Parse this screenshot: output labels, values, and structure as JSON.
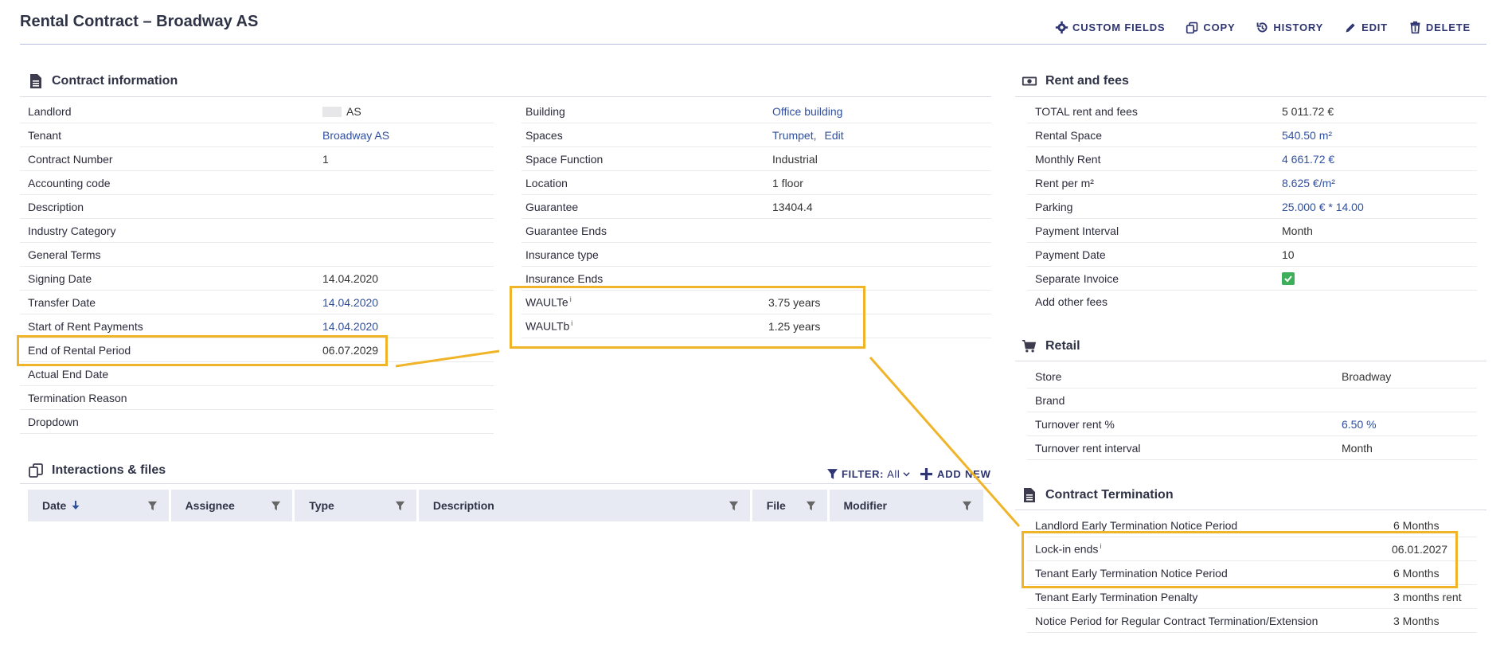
{
  "page_title": "Rental Contract – Broadway AS",
  "toolbar": {
    "custom_fields": "CUSTOM FIELDS",
    "copy": "COPY",
    "history": "HISTORY",
    "edit": "EDIT",
    "delete": "DELETE"
  },
  "contract_info": {
    "title": "Contract information",
    "left_rows": [
      {
        "label": "Landlord",
        "value": "AS"
      },
      {
        "label": "Tenant",
        "value": "Broadway AS"
      },
      {
        "label": "Contract Number",
        "value": "1"
      },
      {
        "label": "Accounting code",
        "value": ""
      },
      {
        "label": "Description",
        "value": ""
      },
      {
        "label": "Industry Category",
        "value": ""
      },
      {
        "label": "General Terms",
        "value": ""
      },
      {
        "label": "Signing Date",
        "value": "14.04.2020"
      },
      {
        "label": "Transfer Date",
        "value": "14.04.2020"
      },
      {
        "label": "Start of Rent Payments",
        "value": "14.04.2020"
      },
      {
        "label": "End of Rental Period",
        "value": "06.07.2029"
      },
      {
        "label": "Actual End Date",
        "value": ""
      },
      {
        "label": "Termination Reason",
        "value": ""
      },
      {
        "label": "Dropdown",
        "value": ""
      }
    ],
    "right_rows": [
      {
        "label": "Building",
        "value": "Office building"
      },
      {
        "label": "Spaces",
        "value": "Trumpet,",
        "extra": "Edit"
      },
      {
        "label": "Space Function",
        "value": "Industrial"
      },
      {
        "label": "Location",
        "value": "1 floor"
      },
      {
        "label": "Guarantee",
        "value": "13404.4"
      },
      {
        "label": "Guarantee Ends",
        "value": ""
      },
      {
        "label": "Insurance type",
        "value": ""
      },
      {
        "label": "Insurance Ends",
        "value": ""
      },
      {
        "label": "WAULTe",
        "sup": "i",
        "value": "3.75 years"
      },
      {
        "label": "WAULTb",
        "sup": "i",
        "value": "1.25 years"
      }
    ]
  },
  "rent_fees": {
    "title": "Rent and fees",
    "rows": [
      {
        "label": "TOTAL rent and fees",
        "value": "5 011.72 €"
      },
      {
        "label": "Rental Space",
        "value": "540.50 m²"
      },
      {
        "label": "Monthly Rent",
        "value": "4 661.72 €"
      },
      {
        "label": "Rent per m²",
        "value": "8.625 €/m²"
      },
      {
        "label": "Parking",
        "value": "25.000 € * 14.00"
      },
      {
        "label": "Payment Interval",
        "value": "Month"
      },
      {
        "label": "Payment Date",
        "value": "10"
      },
      {
        "label": "Separate Invoice",
        "value": ""
      }
    ],
    "add_other_fees": "Add other fees"
  },
  "retail": {
    "title": "Retail",
    "rows": [
      {
        "label": "Store",
        "value": "Broadway"
      },
      {
        "label": "Brand",
        "value": ""
      },
      {
        "label": "Turnover rent %",
        "value": "6.50 %"
      },
      {
        "label": "Turnover rent interval",
        "value": "Month"
      }
    ]
  },
  "termination": {
    "title": "Contract Termination",
    "rows": [
      {
        "label": "Landlord Early Termination Notice Period",
        "value": "6 Months"
      },
      {
        "label": "Lock-in ends",
        "sup": "i",
        "value": "06.01.2027"
      },
      {
        "label": "Tenant Early Termination Notice Period",
        "value": "6 Months"
      },
      {
        "label": "Tenant Early Termination Penalty",
        "value": "3 months rent"
      },
      {
        "label": "Notice Period for Regular Contract Termination/Extension",
        "value": "3 Months"
      }
    ]
  },
  "interactions": {
    "title": "Interactions & files",
    "filter_label": "FILTER:",
    "filter_value": "All",
    "add_new": "ADD NEW",
    "columns": [
      "Date",
      "Assignee",
      "Type",
      "Description",
      "File",
      "Modifier"
    ]
  },
  "colors": {
    "highlight": "#f0b429",
    "link": "#2f4f9f",
    "accent": "#2f3472",
    "header_bg": "#e7e9f3"
  }
}
